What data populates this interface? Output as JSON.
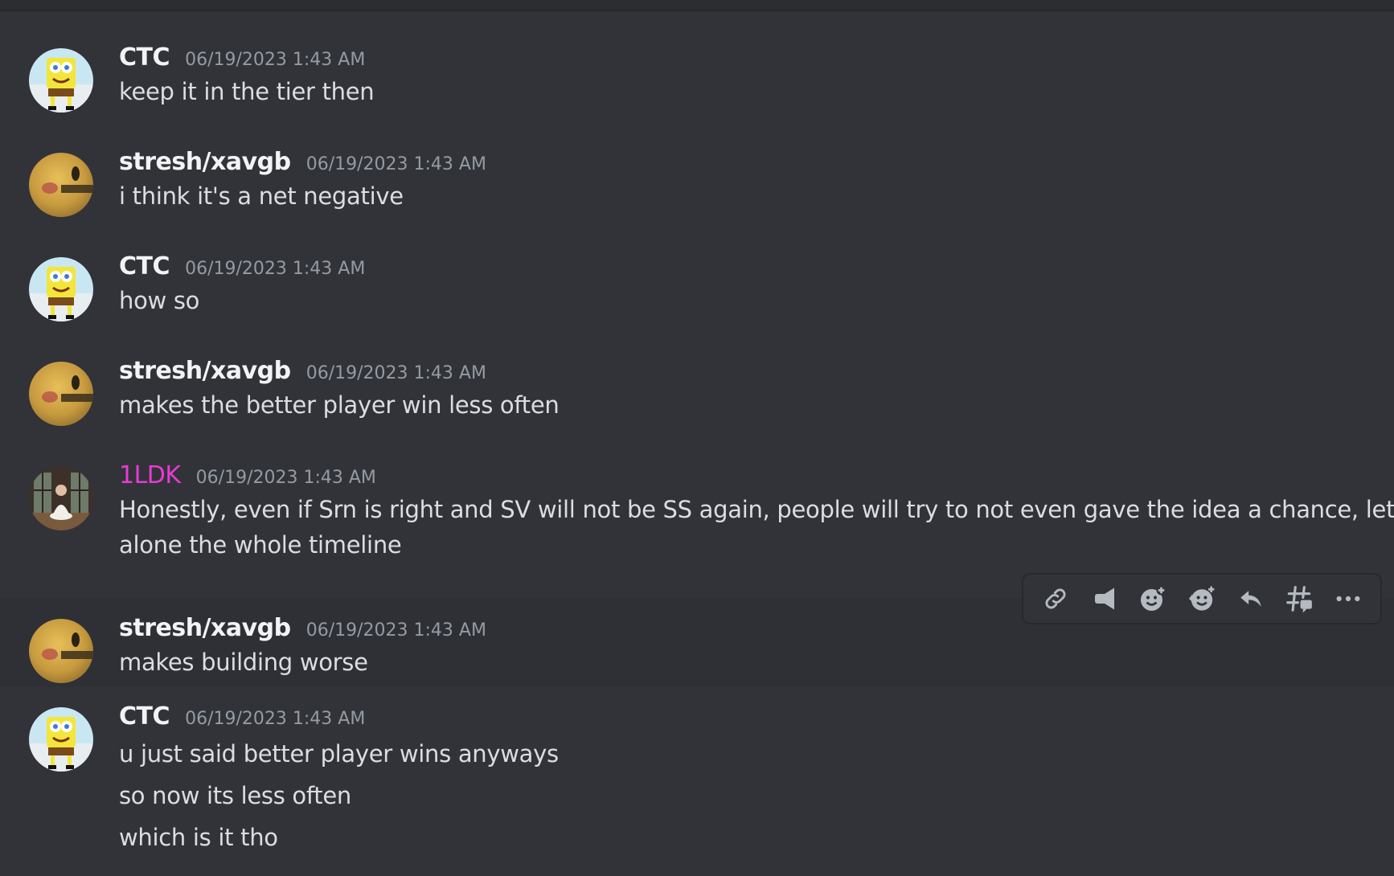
{
  "messages": [
    {
      "author": "CTC",
      "time": "06/19/2023 1:43 AM",
      "lines": [
        "keep it in the tier then"
      ],
      "avatar": "spongebob"
    },
    {
      "author": "stresh/xavgb",
      "time": "06/19/2023 1:43 AM",
      "lines": [
        "i think it's a net negative"
      ],
      "avatar": "blurry-face"
    },
    {
      "author": "CTC",
      "time": "06/19/2023 1:43 AM",
      "lines": [
        "how so"
      ],
      "avatar": "spongebob"
    },
    {
      "author": "stresh/xavgb",
      "time": "06/19/2023 1:43 AM",
      "lines": [
        "makes the better player win less often"
      ],
      "avatar": "blurry-face"
    },
    {
      "author": "1LDK",
      "time": "06/19/2023 1:43 AM",
      "lines": [
        "Honestly, even if Srn is right and SV will not be SS again, people will try to not even gave the idea a chance, let",
        "alone the whole timeline"
      ],
      "avatar": "photo",
      "author_color": "#e93ad4"
    },
    {
      "author": "stresh/xavgb",
      "time": "06/19/2023 1:43 AM",
      "lines": [
        "makes building worse"
      ],
      "avatar": "blurry-face"
    },
    {
      "author": "CTC",
      "time": "06/19/2023 1:43 AM",
      "lines": [
        "u just said better player wins anyways",
        "so now its less often",
        "which is it tho"
      ],
      "avatar": "spongebob"
    }
  ],
  "toolbar": {
    "buttons": [
      "link-icon",
      "megaphone-icon",
      "add-reaction-icon",
      "super-reaction-icon",
      "reply-icon",
      "create-thread-icon",
      "more-icon"
    ]
  },
  "colors": {
    "background": "#313338",
    "hover": "#2e3035",
    "username": "#f2f3f5",
    "pink_username": "#e93ad4",
    "timestamp": "#949ba4",
    "text": "#dbdee1"
  }
}
